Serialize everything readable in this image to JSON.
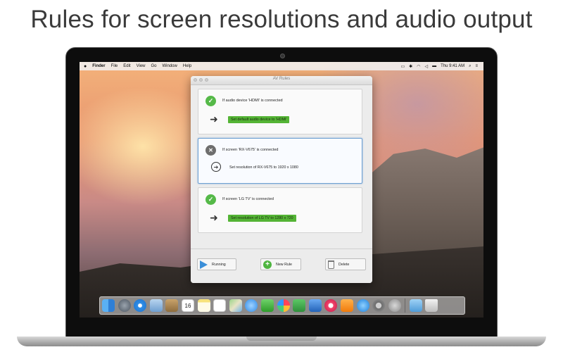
{
  "headline": "Rules for screen resolutions and audio output",
  "menubar": {
    "apple": "",
    "app_name": "Finder",
    "items": [
      "File",
      "Edit",
      "View",
      "Go",
      "Window",
      "Help"
    ],
    "clock": "Thu 9:41 AM"
  },
  "window": {
    "title": "AV Rules",
    "rules": [
      {
        "status": "enabled",
        "status_glyph": "✓",
        "condition": "If audio device 'HDMI' is connected",
        "action": "Set default audio device to 'HDMI'",
        "action_style": "highlight"
      },
      {
        "status": "disabled",
        "status_glyph": "✕",
        "condition": "If screen 'RX-V675' is connected",
        "action": "Set resolution of RX-V675 to 1920 x 1080",
        "action_style": "plain"
      },
      {
        "status": "enabled",
        "status_glyph": "✓",
        "condition": "If screen 'LG TV' is connected",
        "action": "Set resolution of LG TV to 1280 x 720",
        "action_style": "highlight"
      }
    ],
    "buttons": {
      "running": "Running",
      "new_rule": "New Rule",
      "delete": "Delete"
    }
  },
  "dock": {
    "icons": [
      "finder-icon",
      "launchpad-icon",
      "safari-icon",
      "mail-icon",
      "contacts-icon",
      "calendar-icon",
      "notes-icon",
      "reminders-icon",
      "maps-icon",
      "messages-icon",
      "facetime-icon",
      "photos-icon",
      "numbers-icon",
      "keynote-icon",
      "itunes-icon",
      "ibooks-icon",
      "app-store-icon",
      "system-preferences-icon",
      "av-rules-icon",
      "downloads-folder-icon",
      "trash-icon"
    ],
    "calendar_day": "16"
  },
  "colors": {
    "accent_green": "#54b435",
    "status_green": "#55b948",
    "selection_blue": "#6fa1d2",
    "play_blue": "#3b8fd9"
  }
}
